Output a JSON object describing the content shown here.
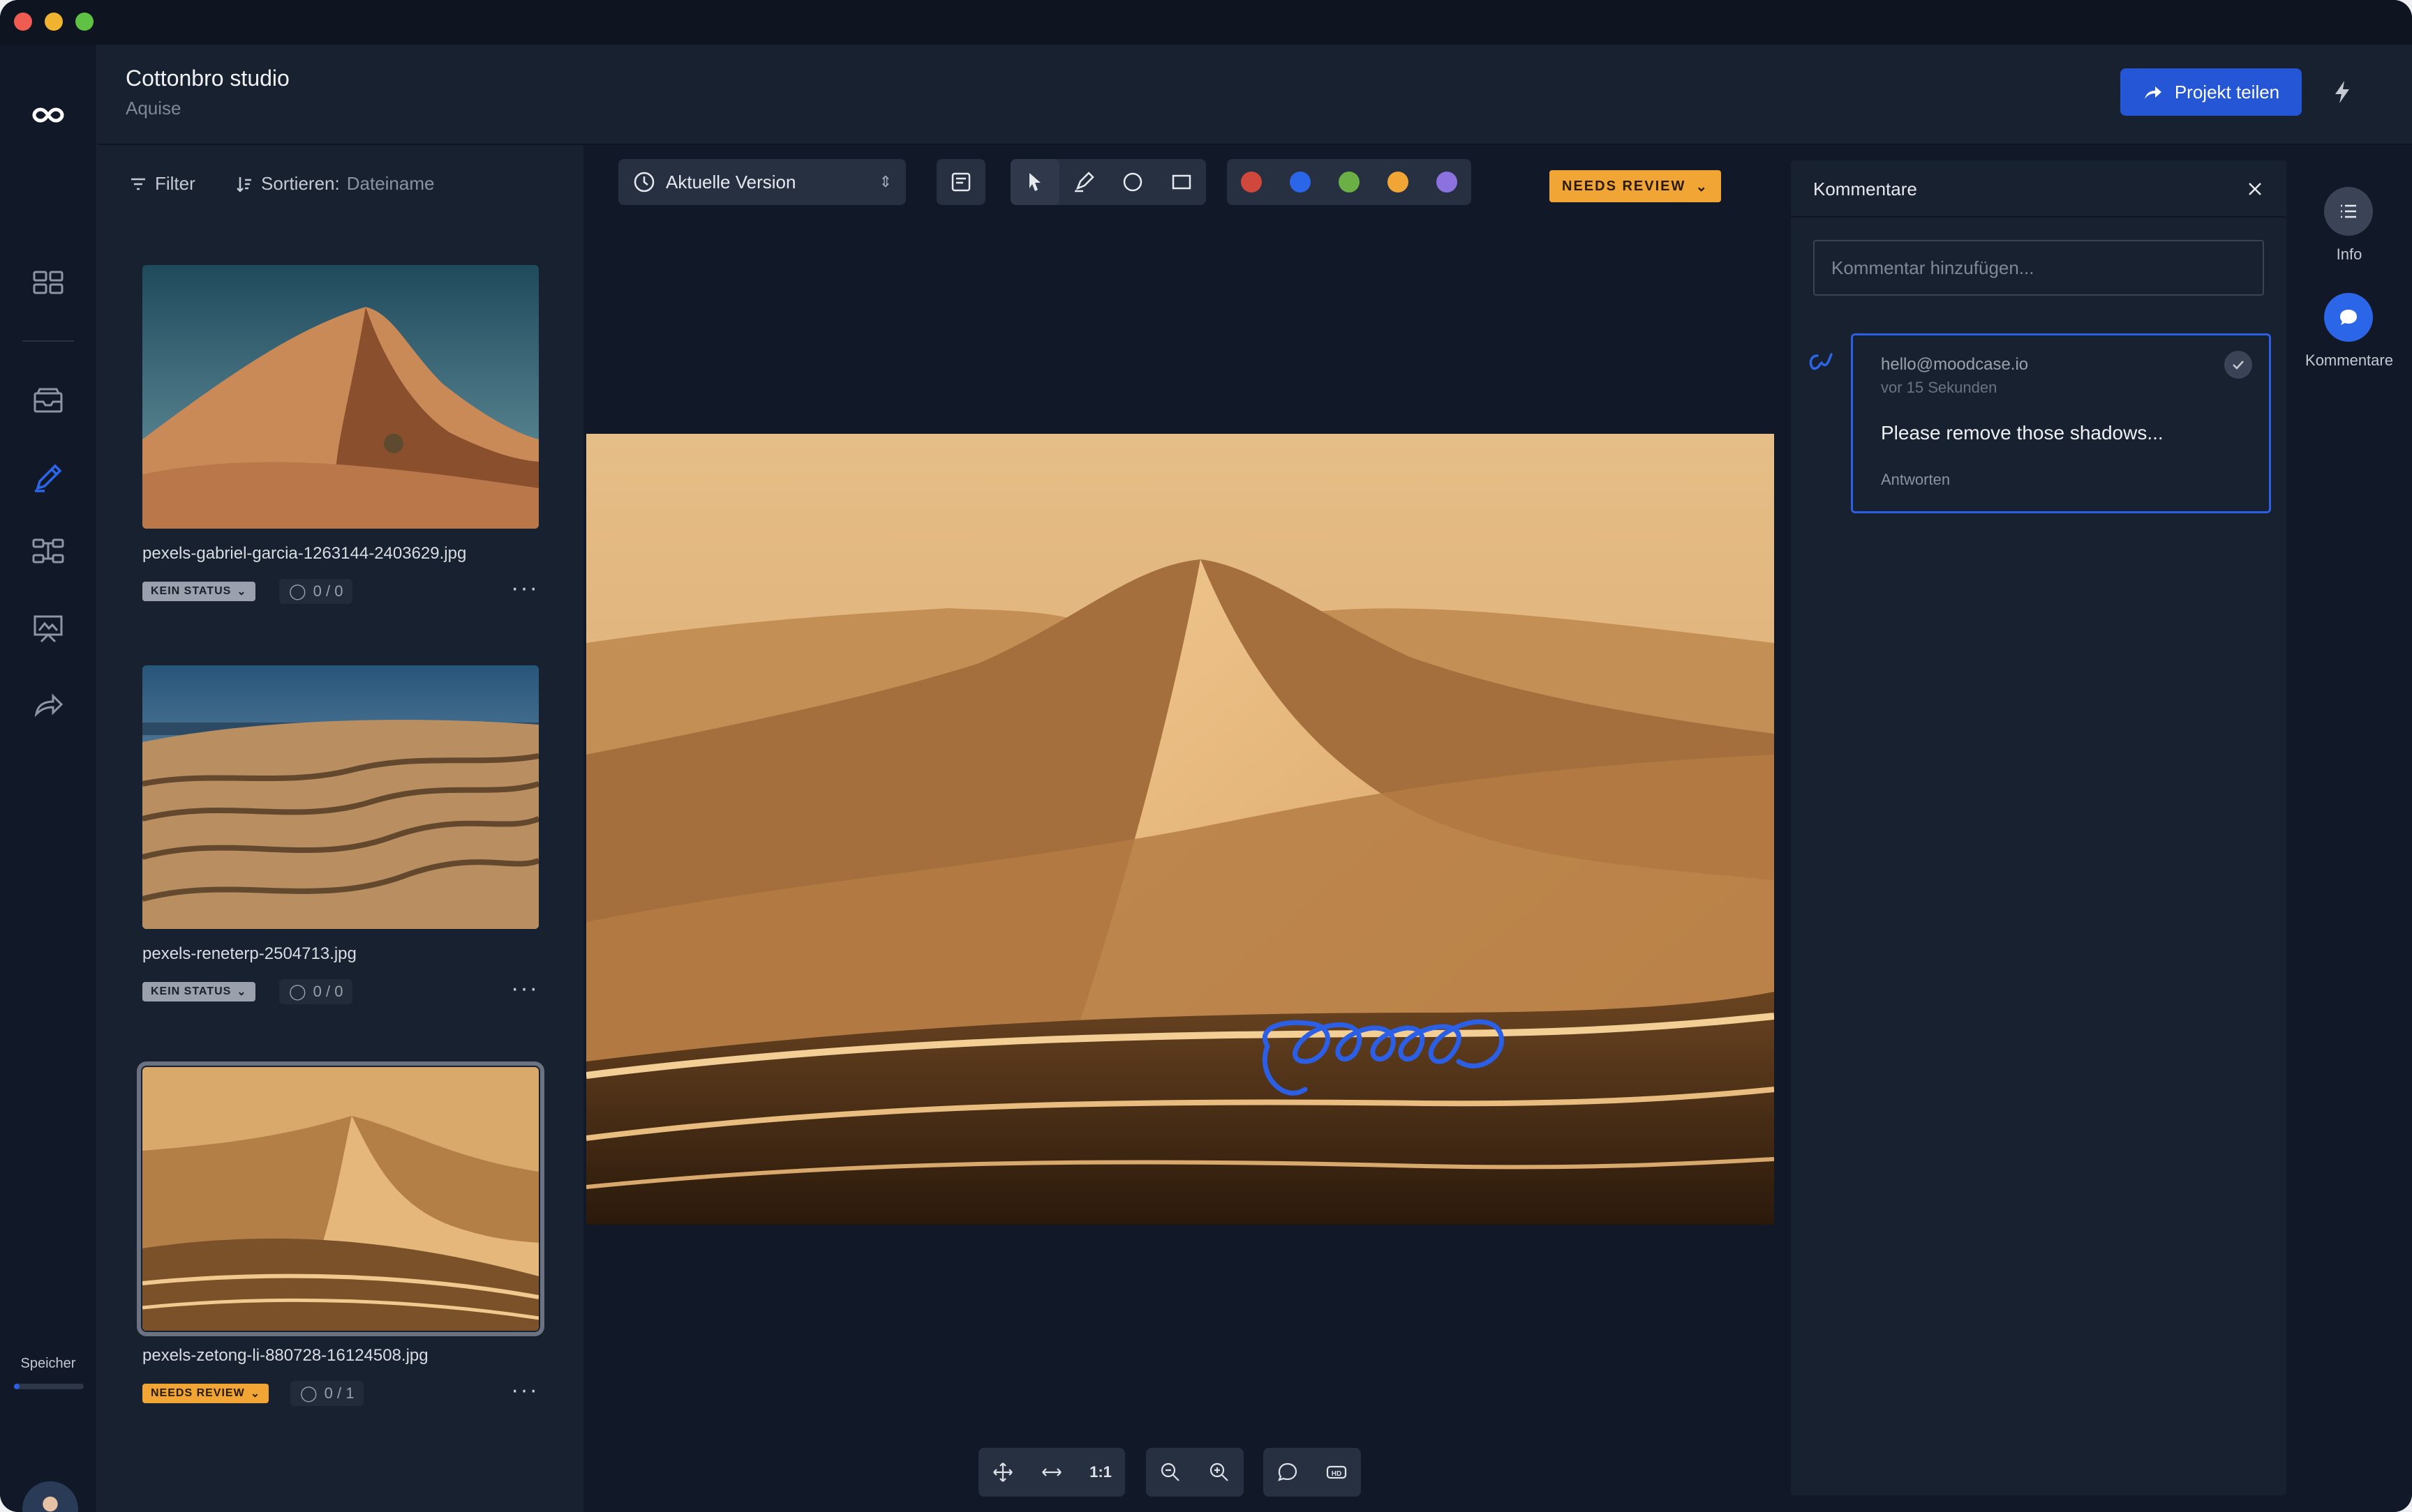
{
  "app": {
    "name": "moodcase"
  },
  "project": {
    "title": "Cottonbro studio",
    "subtitle": "Aquise",
    "share_label": "Projekt teilen"
  },
  "rail": {
    "items": [
      {
        "icon": "infinity-logo-icon"
      },
      {
        "icon": "grid-icon"
      },
      {
        "icon": "inbox-icon"
      },
      {
        "icon": "pencil-icon",
        "active": true
      },
      {
        "icon": "workflow-icon"
      },
      {
        "icon": "presentation-icon"
      },
      {
        "icon": "share-icon"
      }
    ],
    "storage_label": "Speicher",
    "storage_fraction": 0.08
  },
  "filelist": {
    "filter_label": "Filter",
    "sort_label": "Sortieren:",
    "sort_value": "Dateiname",
    "files": [
      {
        "name": "pexels-gabriel-garcia-1263144-2403629.jpg",
        "status": "KEIN STATUS",
        "count": "0 / 0"
      },
      {
        "name": "pexels-reneterp-2504713.jpg",
        "status": "KEIN STATUS",
        "count": "0 / 0"
      },
      {
        "name": "pexels-zetong-li-880728-16124508.jpg",
        "status": "NEEDS REVIEW",
        "count": "0 / 1",
        "selected": true
      }
    ]
  },
  "viewer": {
    "version_label": "Aktuelle Version",
    "review_status": "NEEDS REVIEW",
    "colors": [
      "#d0483c",
      "#2b66e8",
      "#6bb046",
      "#f0a534",
      "#8c72df"
    ],
    "zoom_label": "1:1"
  },
  "comments": {
    "title": "Kommentare",
    "input_placeholder": "Kommentar hinzufügen...",
    "items": [
      {
        "author": "hello@moodcase.io",
        "time": "vor 15 Sekunden",
        "text": "Please remove those shadows...",
        "reply_label": "Antworten"
      }
    ]
  },
  "rightrail": {
    "info_label": "Info",
    "comments_label": "Kommentare"
  }
}
